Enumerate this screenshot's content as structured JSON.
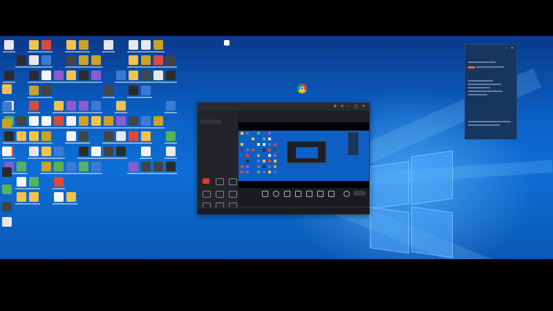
{
  "recorder": {
    "logo_brand": "",
    "logo_name": "",
    "badge": "",
    "tabs": [
      {
        "label": ""
      },
      {
        "label": ""
      },
      {
        "label": ""
      }
    ],
    "status_left": "",
    "status_right": "",
    "record_color": "#e03c2c",
    "accent_color": "#ff6a3c"
  },
  "desktop": {
    "wallpaper_color": "#0b62c8",
    "icons": [
      "folder-icon",
      "app-icon",
      "document-icon",
      "game-icon",
      "chrome-icon"
    ]
  },
  "panel": {
    "title": "",
    "badge_color": "#ff6a3c"
  }
}
